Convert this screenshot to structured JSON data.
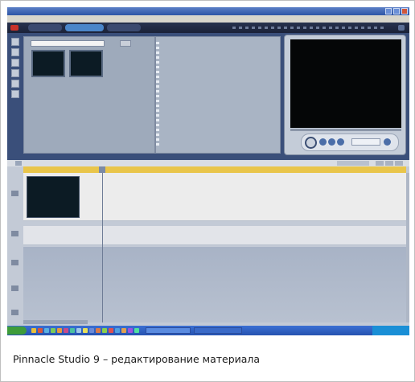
{
  "caption": "Pinnacle Studio 9 – редактирование материала",
  "app": {
    "colors": {
      "mode_tab_active": "#4b86c9",
      "timeline_ruler": "#e9c54a",
      "taskbar": "#2552b0",
      "start_button": "#3e9c3a",
      "preview_screen": "#050607",
      "clip_thumbnail": "#0c1b24"
    }
  }
}
